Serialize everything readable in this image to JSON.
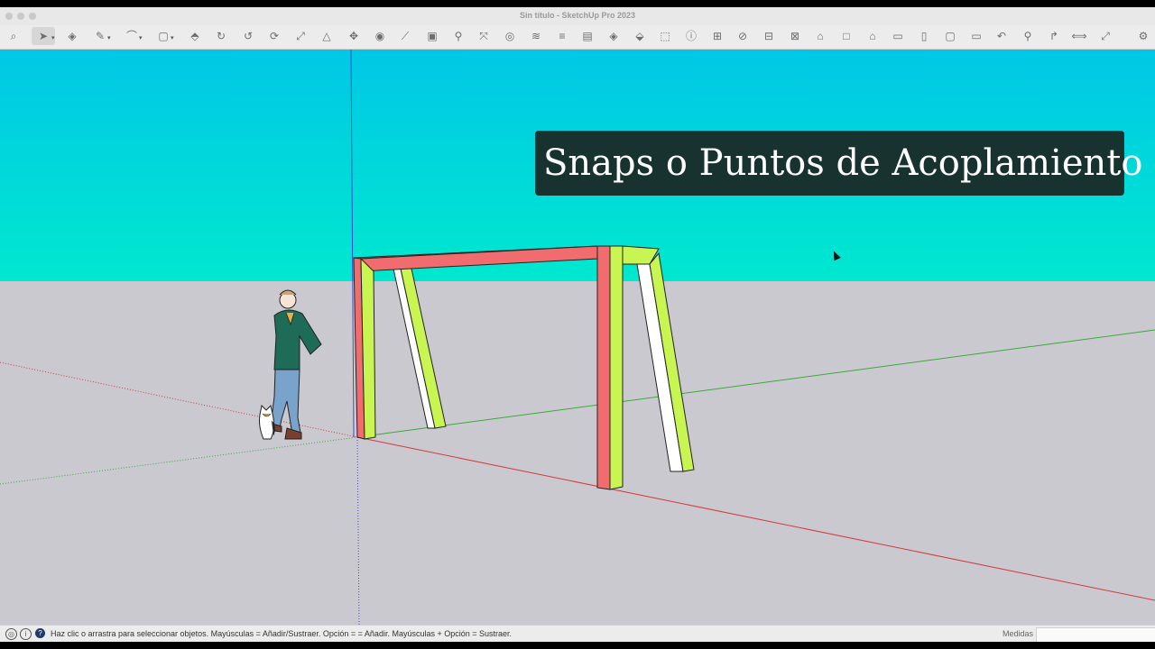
{
  "window": {
    "title": "Sin título - SketchUp Pro 2023"
  },
  "toolbar": {
    "tools": [
      {
        "name": "search-tool",
        "glyph": "⌕"
      },
      {
        "name": "select-tool",
        "glyph": "➤"
      },
      {
        "name": "eraser-tool",
        "glyph": "◈"
      },
      {
        "name": "pencil-tool",
        "glyph": "✎"
      },
      {
        "name": "arc-tool",
        "glyph": "⌒"
      },
      {
        "name": "rectangle-tool",
        "glyph": "▢"
      },
      {
        "name": "push-pull-tool",
        "glyph": "⬘"
      },
      {
        "name": "rotate-tool",
        "glyph": "↻"
      },
      {
        "name": "follow-me-tool",
        "glyph": "↺"
      },
      {
        "name": "orbit-tool",
        "glyph": "⟳"
      },
      {
        "name": "scale-tool",
        "glyph": "⤢"
      },
      {
        "name": "protractor-tool",
        "glyph": "△"
      },
      {
        "name": "move-tool",
        "glyph": "✥"
      },
      {
        "name": "paint-tool",
        "glyph": "◉"
      },
      {
        "name": "tape-tool",
        "glyph": "⟋"
      },
      {
        "name": "text-tool",
        "glyph": "▣"
      },
      {
        "name": "zoom-tool",
        "glyph": "⚲"
      },
      {
        "name": "zoom-extents-tool",
        "glyph": "⤧"
      },
      {
        "name": "components-tool",
        "glyph": "◎"
      },
      {
        "name": "styles-tool",
        "glyph": "≋"
      },
      {
        "name": "layers-tool",
        "glyph": "≡"
      },
      {
        "name": "scenes-tool",
        "glyph": "▤"
      },
      {
        "name": "position-camera-tool",
        "glyph": "◈"
      },
      {
        "name": "warehouse-tool",
        "glyph": "⬙"
      },
      {
        "name": "extension-tool",
        "glyph": "⬚"
      },
      {
        "name": "info-tool",
        "glyph": "ⓘ"
      },
      {
        "name": "sandbox-tool",
        "glyph": "⊞"
      },
      {
        "name": "section-tool",
        "glyph": "⊘"
      },
      {
        "name": "outliner-tool",
        "glyph": "⊟"
      },
      {
        "name": "solid-tool",
        "glyph": "⊠"
      },
      {
        "name": "view-iso-tool",
        "glyph": "⌂"
      },
      {
        "name": "view-top-tool",
        "glyph": "□"
      },
      {
        "name": "view-front-tool",
        "glyph": "⌂"
      },
      {
        "name": "view-right-tool",
        "glyph": "▭"
      },
      {
        "name": "view-back-tool",
        "glyph": "▯"
      },
      {
        "name": "view-left-tool",
        "glyph": "▢"
      },
      {
        "name": "view-bottom-tool",
        "glyph": "▭"
      },
      {
        "name": "undo-view-tool",
        "glyph": "↶"
      },
      {
        "name": "magnify-tool",
        "glyph": "⚲"
      },
      {
        "name": "walk-tool",
        "glyph": "↱"
      },
      {
        "name": "pan-tool",
        "glyph": "⟺"
      },
      {
        "name": "expand-tool",
        "glyph": "⤢"
      }
    ],
    "settings_glyph": "⚙"
  },
  "overlay": {
    "title": "Snaps o Puntos de Acoplamiento"
  },
  "viewport": {
    "sky_top_color": "#00c7e6",
    "sky_bottom_color": "#00e8cf",
    "ground_color": "#cbc9d0",
    "frame_red": "#f16c6f",
    "frame_green": "#c8f552",
    "axis_red": "#d23b3b",
    "axis_green": "#3aa93a",
    "axis_blue": "#3d4fd1"
  },
  "statusbar": {
    "help_text": "Haz clic o arrastra para seleccionar objetos. Mayúsculas = Añadir/Sustraer. Opción = = Añadir. Mayúsculas + Opción = Sustraer.",
    "measure_label": "Medidas",
    "measure_value": ""
  }
}
